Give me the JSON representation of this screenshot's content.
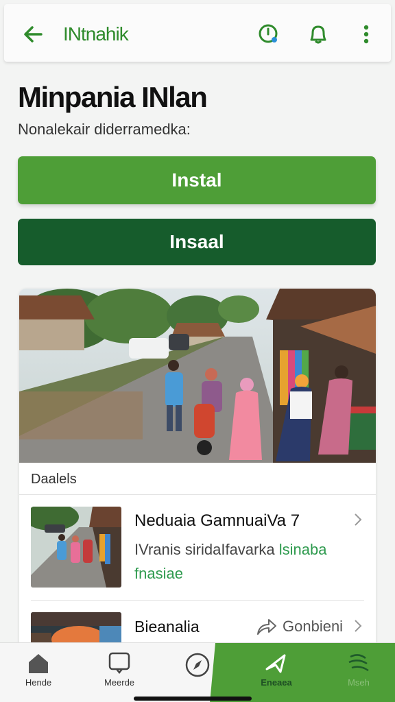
{
  "header": {
    "title": "INtnahik",
    "back_icon": "arrow-left-icon",
    "actions": [
      "alert-clock-icon",
      "bell-icon",
      "more-vert-icon"
    ]
  },
  "page": {
    "title": "Minpania INlan",
    "subtitle": "Nonalekair diderramedka:"
  },
  "buttons": {
    "primary_label": "Instal",
    "secondary_label": "Insaal"
  },
  "card": {
    "section_label": "Daalels",
    "items": [
      {
        "title": "Neduaia GamnuaiVa 7",
        "desc_plain": "IVranis siridaIfavarka ",
        "desc_highlight": "lsinaba fnasiae"
      },
      {
        "title": "Bieanalia",
        "action_label": "Gonbieni",
        "action_icon": "share-arrow-icon"
      }
    ]
  },
  "bottom_nav": [
    {
      "label": "Hende",
      "icon": "home-icon"
    },
    {
      "label": "Meerde",
      "icon": "message-icon"
    },
    {
      "label": "",
      "icon": "compass-icon"
    },
    {
      "label": "Eneaea",
      "icon": "send-icon"
    },
    {
      "label": "Mseh",
      "icon": "cart-icon"
    }
  ],
  "colors": {
    "accent_green": "#4e9e37",
    "dark_green": "#165c2c",
    "title_green": "#2f8b2c",
    "highlight_green": "#2e9a4e"
  }
}
